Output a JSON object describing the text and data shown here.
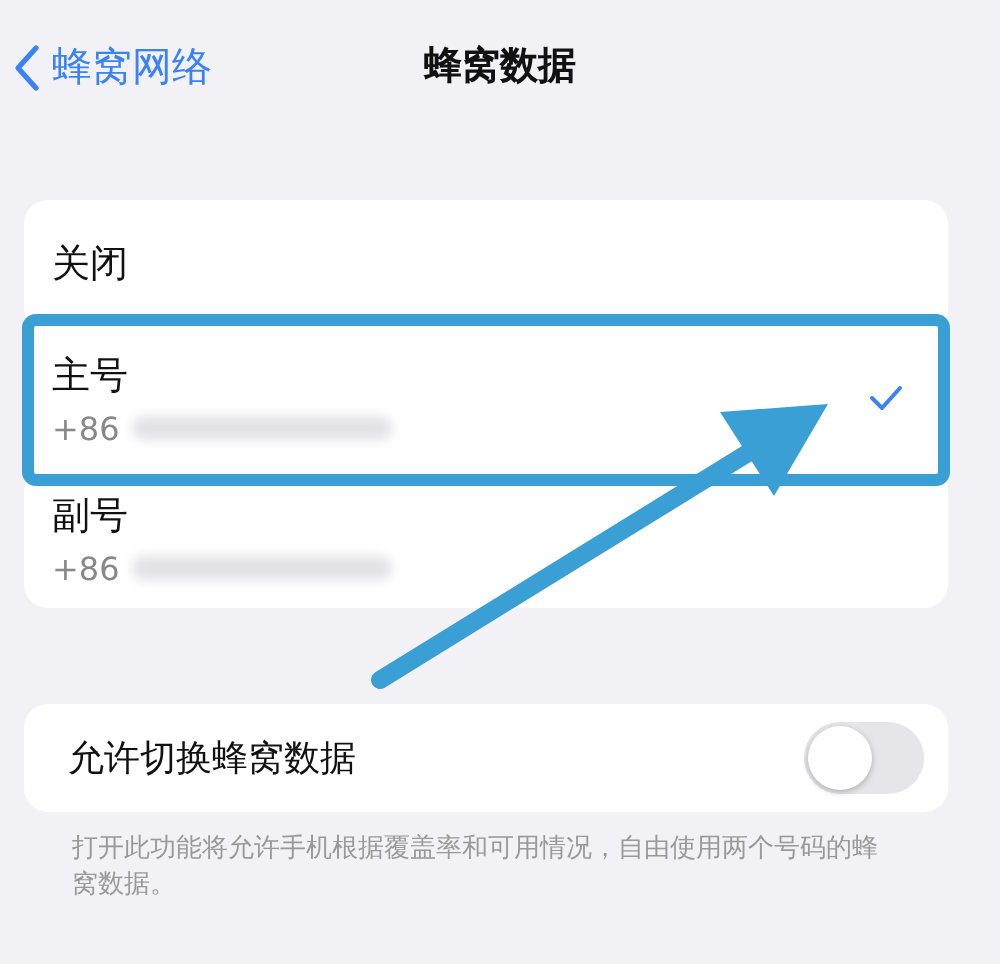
{
  "nav": {
    "back": "蜂窝网络",
    "title": "蜂窝数据"
  },
  "options": [
    {
      "label": "关闭",
      "selected": false
    },
    {
      "label": "主号",
      "number": "+86",
      "selected": true
    },
    {
      "label": "副号",
      "number": "+86",
      "selected": false
    }
  ],
  "switch_row": {
    "label": "允许切换蜂窝数据",
    "on": false
  },
  "footnote": "打开此功能将允许手机根据覆盖率和可用情况，自由使用两个号码的蜂窝数据。"
}
